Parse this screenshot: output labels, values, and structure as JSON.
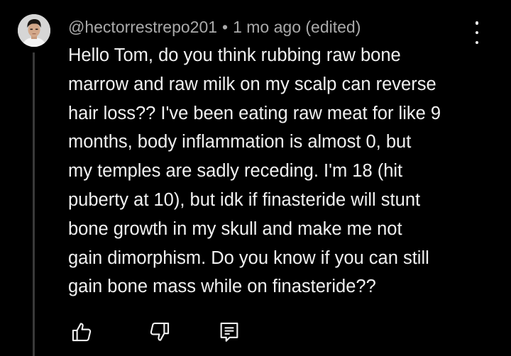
{
  "comment": {
    "author": "@hectorrestrepo201",
    "separator": "•",
    "timestamp": "1 mo ago (edited)",
    "lines": [
      "Hello Tom, do you think rubbing raw bone",
      "marrow and raw milk on my scalp can reverse",
      "hair loss?? I've been eating raw meat for like 9",
      "months, body inflammation is almost 0, but",
      "my temples are sadly receding. I'm 18 (hit",
      "puberty at 10), but idk if finasteride will stunt",
      "bone growth in my skull and make me not",
      "gain dimorphism. Do you know if you can still",
      "gain bone mass while on finasteride??"
    ]
  },
  "icons": {
    "avatar": "user-avatar",
    "menu": "more-vertical-icon",
    "like": "thumbs-up-icon",
    "dislike": "thumbs-down-icon",
    "reply": "reply-comment-icon"
  },
  "colors": {
    "background": "#000000",
    "text_primary": "#f1f1f1",
    "text_secondary": "#aaaaaa",
    "thread_line": "#3a3a3a"
  }
}
